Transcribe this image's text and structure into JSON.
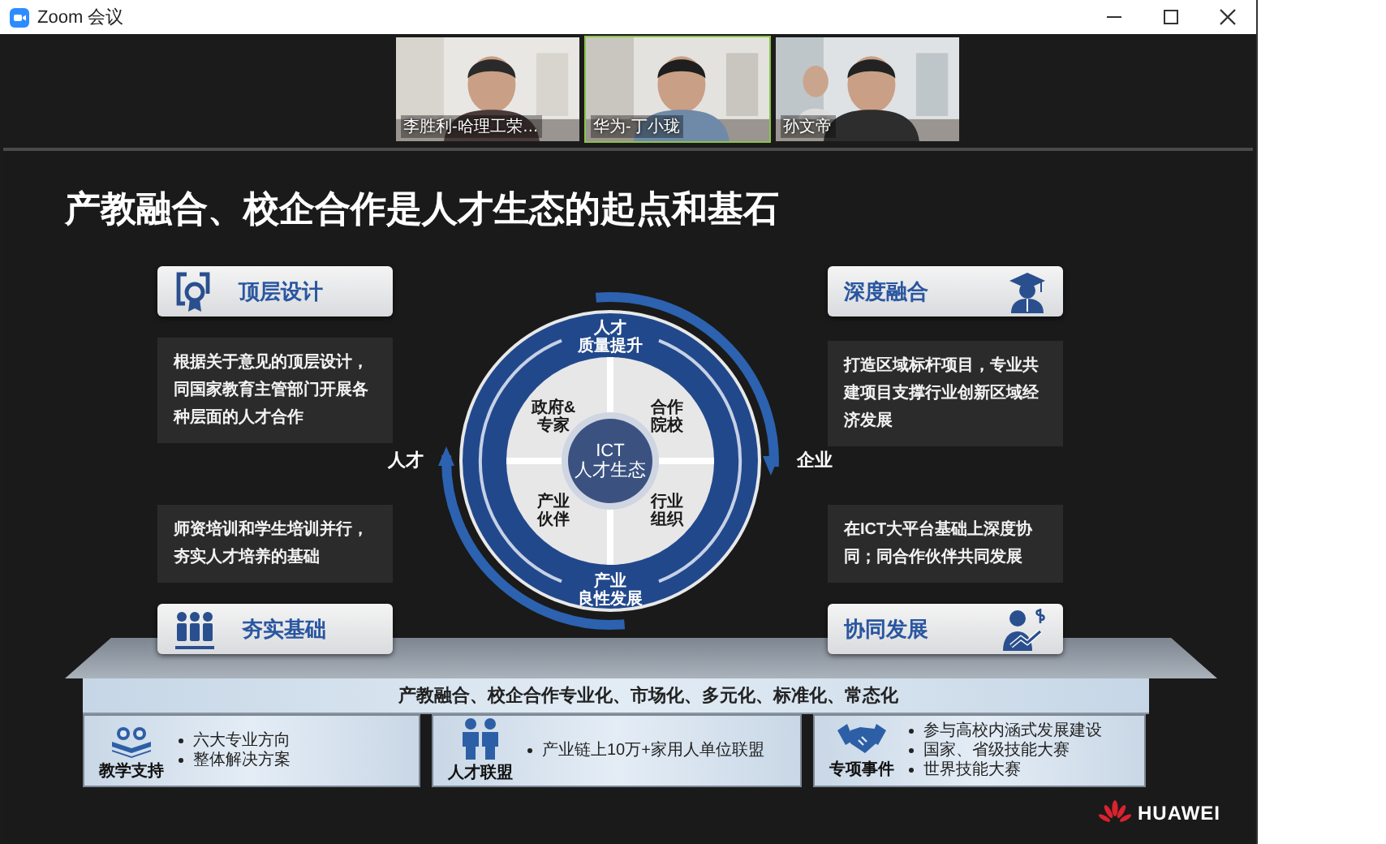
{
  "window": {
    "title": "Zoom 会议"
  },
  "participants": [
    {
      "name": "李胜利-哈理工荣…",
      "speaking": false
    },
    {
      "name": "华为-丁小珑",
      "speaking": true
    },
    {
      "name": "孙文帝",
      "speaking": false
    }
  ],
  "slide": {
    "title": "产教融合、校企合作是人才生态的起点和基石",
    "top_left": {
      "heading": "顶层设计",
      "description": "根据关于意见的顶层设计，同国家教育主管部门开展各种层面的人才合作"
    },
    "bottom_left": {
      "heading": "夯实基础",
      "description": "师资培训和学生培训并行，夯实人才培养的基础"
    },
    "top_right": {
      "heading": "深度融合",
      "description": "打造区域标杆项目，专业共建项目支撑行业创新区域经济发展"
    },
    "bottom_right": {
      "heading": "协同发展",
      "description": "在ICT大平台基础上深度协同；同合作伙伴共同发展"
    },
    "ecosystem": {
      "left_label": "人才",
      "right_label": "企业",
      "ring_top": [
        "人才",
        "质量提升"
      ],
      "ring_bottom": [
        "产业",
        "良性发展"
      ],
      "quadrants": [
        [
          "政府&",
          "专家"
        ],
        [
          "合作",
          "院校"
        ],
        [
          "产业",
          "伙伴"
        ],
        [
          "行业",
          "组织"
        ]
      ],
      "center": [
        "ICT",
        "人才生态"
      ]
    },
    "platform": {
      "banner": "产教融合、校企合作专业化、市场化、多元化、标准化、常态化",
      "columns": [
        {
          "caption": "教学支持",
          "bullets": [
            "六大专业方向",
            "整体解决方案"
          ]
        },
        {
          "caption": "人才联盟",
          "bullets": [
            "产业链上10万+家用人单位联盟"
          ]
        },
        {
          "caption": "专项事件",
          "bullets": [
            "参与高校内涵式发展建设",
            "国家、省级技能大赛",
            "世界技能大赛"
          ]
        }
      ]
    },
    "brand": "HUAWEI"
  }
}
